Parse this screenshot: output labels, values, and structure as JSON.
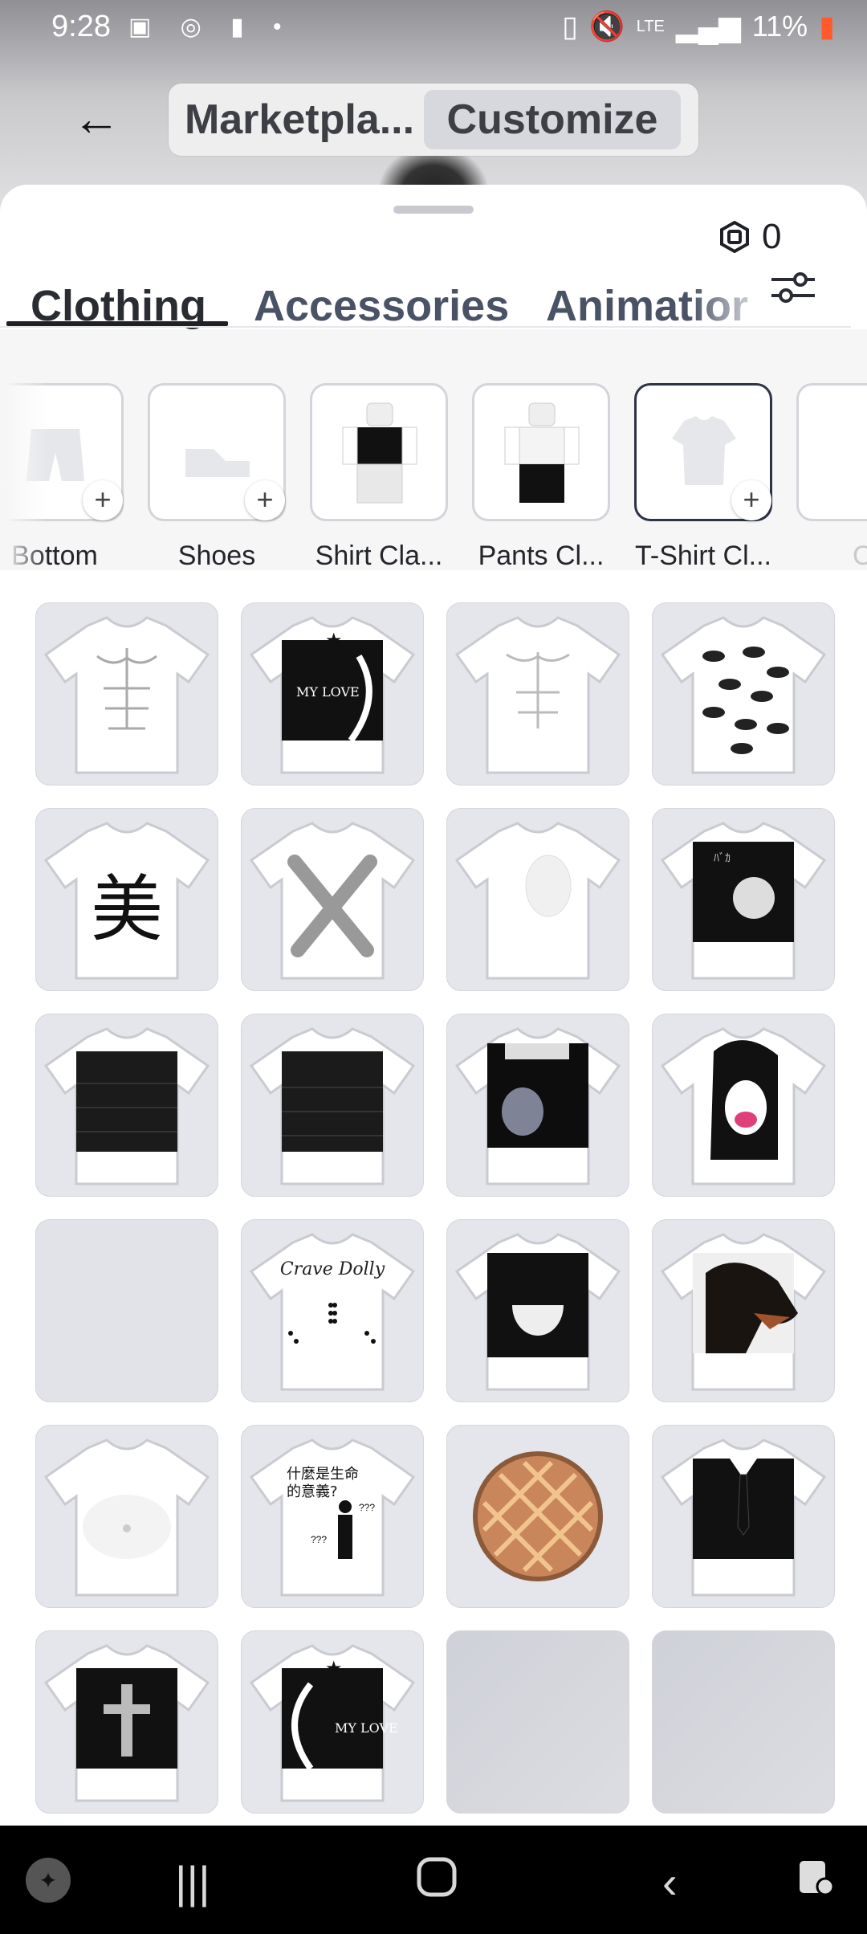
{
  "status_bar": {
    "time": "9:28",
    "battery": "11%",
    "network": "LTE"
  },
  "top_nav": {
    "back_label": "←",
    "segments": [
      "Marketpla...",
      "Customize"
    ],
    "active_segment": "Customize"
  },
  "currency": {
    "amount": "0",
    "icon": "robux-icon"
  },
  "tabs": [
    {
      "label": "Clothing",
      "active": true
    },
    {
      "label": "Accessories",
      "active": false
    },
    {
      "label": "Animatior",
      "active": false
    }
  ],
  "categories": [
    {
      "label": "Bottom",
      "icon": "shorts-icon"
    },
    {
      "label": "Shoes",
      "icon": "shoe-icon"
    },
    {
      "label": "Shirt Cla...",
      "icon": "avatar-thumbnail"
    },
    {
      "label": "Pants Cl...",
      "icon": "avatar-thumbnail"
    },
    {
      "label": "T-Shirt Cl...",
      "icon": "tshirt-icon",
      "selected": true
    },
    {
      "label": "Cl",
      "icon": "partial"
    }
  ],
  "items": {
    "print_texts": {
      "my_love": "MY LOVE",
      "kanji": "美",
      "crave": "Crave Dolly",
      "meaning": "什麼是生命的意義?",
      "qmarks": "???"
    }
  },
  "colors": {
    "tile_bg": "#e4e6ec",
    "selected_border": "#2e3348",
    "text_primary": "#2a2c33",
    "tab_inactive": "#4a5366"
  }
}
